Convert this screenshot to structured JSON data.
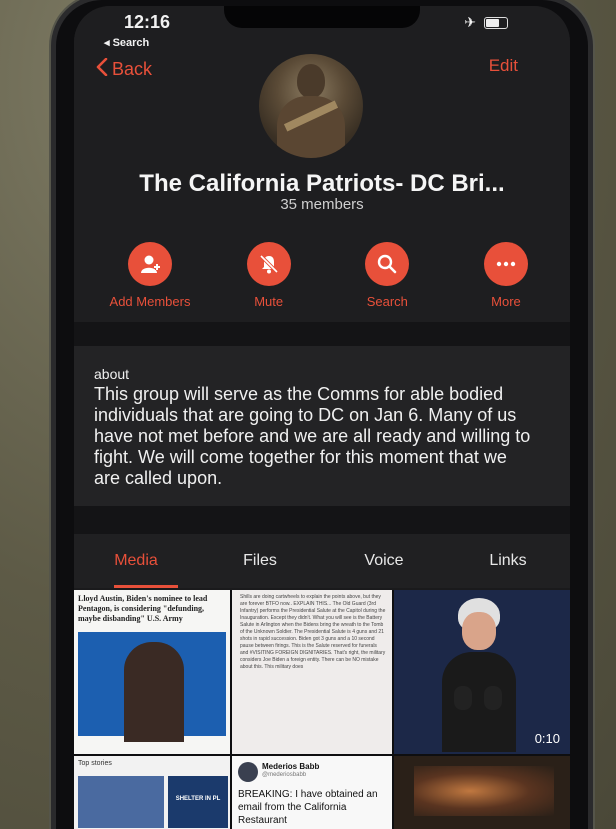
{
  "status_bar": {
    "time": "12:16",
    "back_app": "◂ Search"
  },
  "nav": {
    "back_label": "Back",
    "edit_label": "Edit"
  },
  "group": {
    "title": "The California Patriots- DC Bri...",
    "members": "35 members"
  },
  "actions": [
    {
      "label": "Add Members",
      "icon": "add-user-icon"
    },
    {
      "label": "Mute",
      "icon": "bell-off-icon"
    },
    {
      "label": "Search",
      "icon": "search-icon"
    },
    {
      "label": "More",
      "icon": "more-icon"
    }
  ],
  "about": {
    "label": "about",
    "text": "This group will serve as the Comms for able bodied individuals that are going to DC on Jan 6. Many of us have not met before and we are all ready and willing to fight. We will come together for this moment that we are called upon."
  },
  "tabs": [
    {
      "label": "Media",
      "active": true
    },
    {
      "label": "Files",
      "active": false
    },
    {
      "label": "Voice",
      "active": false
    },
    {
      "label": "Links",
      "active": false
    }
  ],
  "media": {
    "tile1_headline": "Lloyd Austin, Biden's nominee to lead Pentagon, is considering \"defunding, maybe disbanding\" U.S. Army",
    "tile2_text": "Shills are doing cartwheels to explain the points above, but they are forever BTFO now.. EXPLAIN THIS... The Old Guard (3rd Infantry) performs the Presidential Salute at the Capitol during the Inauguration. Except they didn't. What you will see is the Battery Salute in Arlington when the Bidens bring the wreath to the Tomb of the Unknown Soldier. The Presidential Salute is 4 guns and 21 shots in rapid succession. Biden got 3 guns and a 10 second pause between firings. This is the Salute reserved for funerals and #VISITING FOREIGN DIGNITARIES. That's right, the military considers Joe Biden a foreign entity. There can be NO mistake about this. This military does",
    "tile3_duration": "0:10",
    "tile4_header": "Top stories",
    "tile4_badge": "SHELTER IN PL",
    "tile5_name": "Mederios Babb",
    "tile5_handle": "@mederiosbabb",
    "tile5_text": "BREAKING: I have obtained an email from the California Restaurant"
  },
  "colors": {
    "accent": "#e8503a",
    "background": "#1a1a1c"
  }
}
